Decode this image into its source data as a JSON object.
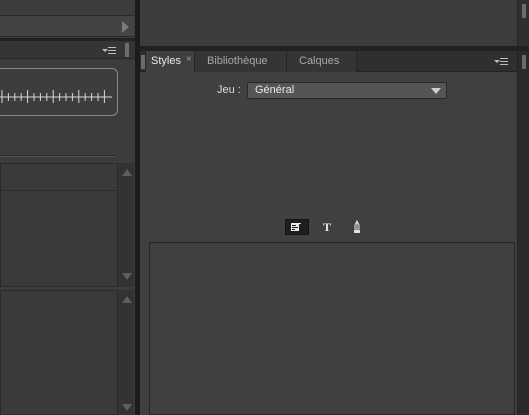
{
  "tabs": [
    {
      "label": "Styles",
      "active": true,
      "closable": true
    },
    {
      "label": "Bibliothèque",
      "active": false
    },
    {
      "label": "Calques",
      "active": false
    }
  ],
  "styles_panel": {
    "set_label": "Jeu :",
    "set_value": "Général",
    "style_type_buttons": [
      "paragraph-style-icon",
      "character-style-icon",
      "object-style-icon"
    ],
    "char_glyph": "T"
  },
  "icons": {
    "close": "×",
    "panel_menu": "panel-menu-icon",
    "grip": "grip-icon"
  },
  "colors": {
    "panel_bg": "#404040",
    "tab_active_bg": "#404040",
    "tab_inactive_bg": "#353535",
    "divider": "#1c1c1c"
  }
}
